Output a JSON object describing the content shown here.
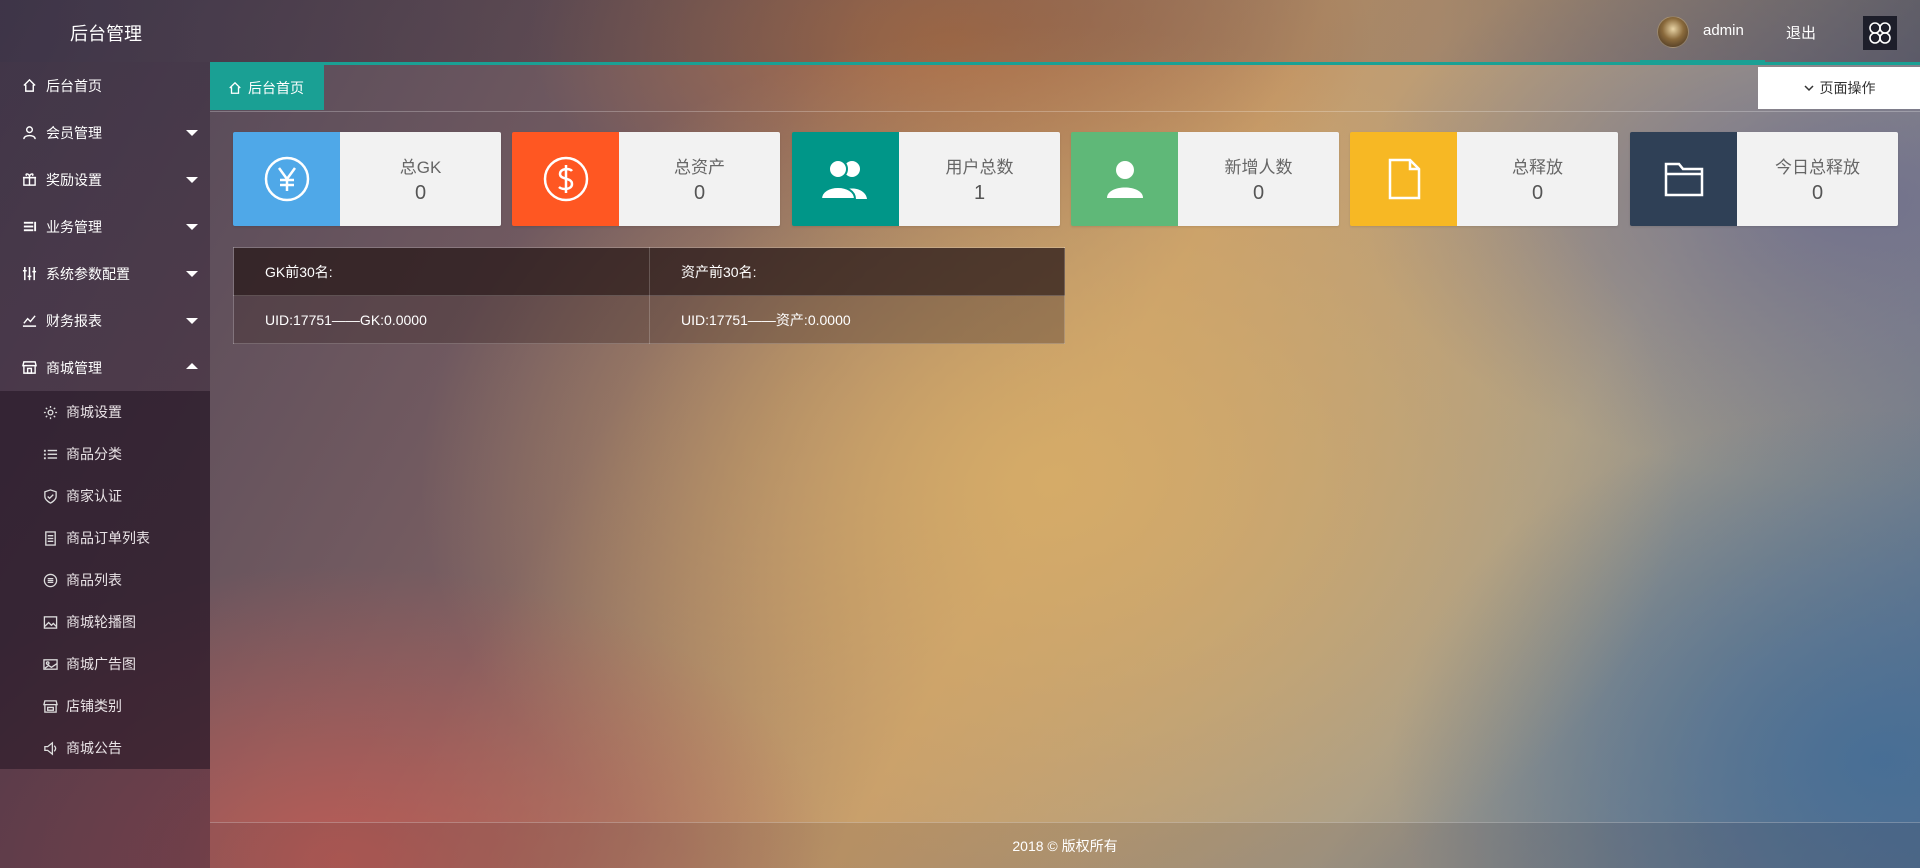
{
  "header": {
    "title": "后台管理",
    "username": "admin",
    "logout_label": "退出"
  },
  "sidebar": {
    "items": [
      {
        "label": "后台首页",
        "icon": "home-icon"
      },
      {
        "label": "会员管理",
        "icon": "user-icon"
      },
      {
        "label": "奖励设置",
        "icon": "gift-icon"
      },
      {
        "label": "业务管理",
        "icon": "list-icon"
      },
      {
        "label": "系统参数配置",
        "icon": "sliders-icon"
      },
      {
        "label": "财务报表",
        "icon": "chart-icon"
      },
      {
        "label": "商城管理",
        "icon": "store-icon"
      }
    ],
    "submenu": [
      {
        "label": "商城设置",
        "icon": "gear-icon"
      },
      {
        "label": "商品分类",
        "icon": "list-icon"
      },
      {
        "label": "商家认证",
        "icon": "shield-check-icon"
      },
      {
        "label": "商品订单列表",
        "icon": "document-icon"
      },
      {
        "label": "商品列表",
        "icon": "circle-list-icon"
      },
      {
        "label": "商城轮播图",
        "icon": "image-icon"
      },
      {
        "label": "商城广告图",
        "icon": "photo-icon"
      },
      {
        "label": "店铺类别",
        "icon": "shop-icon"
      },
      {
        "label": "商城公告",
        "icon": "speaker-icon"
      }
    ]
  },
  "tabs": {
    "active_label": "后台首页",
    "page_ops_label": "页面操作"
  },
  "stats": [
    {
      "label": "总GK",
      "value": "0",
      "color": "#4fa8e8",
      "icon": "yen-icon"
    },
    {
      "label": "总资产",
      "value": "0",
      "color": "#ff5722",
      "icon": "dollar-icon"
    },
    {
      "label": "用户总数",
      "value": "1",
      "color": "#009688",
      "icon": "users-icon"
    },
    {
      "label": "新增人数",
      "value": "0",
      "color": "#5fb878",
      "icon": "user-icon"
    },
    {
      "label": "总释放",
      "value": "0",
      "color": "#f7b824",
      "icon": "file-icon"
    },
    {
      "label": "今日总释放",
      "value": "0",
      "color": "#2f4056",
      "icon": "folder-icon"
    }
  ],
  "ranking": {
    "headers": [
      "GK前30名:",
      "资产前30名:"
    ],
    "rows": [
      [
        "UID:17751——GK:0.0000",
        "UID:17751——资产:0.0000"
      ]
    ]
  },
  "footer": {
    "text": "2018 © 版权所有"
  }
}
